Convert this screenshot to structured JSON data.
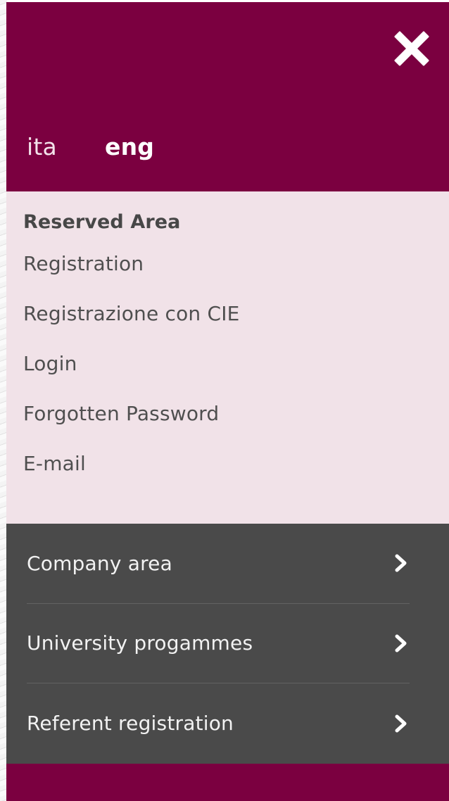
{
  "colors": {
    "brand": "#7b0040",
    "reserved_bg": "#f1e2e8",
    "dark_bg": "#4a4a4a",
    "text_light": "#ffffff"
  },
  "header": {
    "close_icon": "close-icon",
    "languages": [
      {
        "label": "ita",
        "active": false
      },
      {
        "label": "eng",
        "active": true
      }
    ]
  },
  "reserved_area": {
    "title": "Reserved Area",
    "links": [
      {
        "label": "Registration"
      },
      {
        "label": "Registrazione con CIE"
      },
      {
        "label": "Login"
      },
      {
        "label": "Forgotten Password"
      },
      {
        "label": "E-mail"
      }
    ]
  },
  "main_nav": {
    "items": [
      {
        "label": "Company area",
        "icon": "chevron-right-icon"
      },
      {
        "label": "University progammes",
        "icon": "chevron-right-icon"
      },
      {
        "label": "Referent registration",
        "icon": "chevron-right-icon"
      }
    ]
  }
}
